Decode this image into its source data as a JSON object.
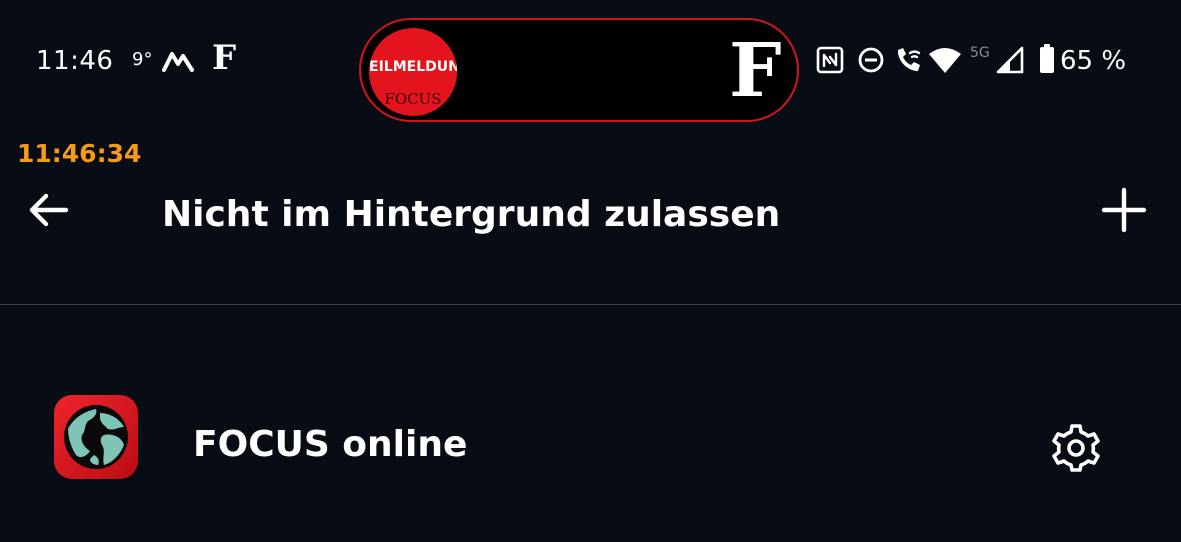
{
  "status_bar": {
    "time": "11:46",
    "temperature": "9°",
    "battery": "65 %",
    "network_label": "5G",
    "icons": [
      "mountain-app-icon",
      "focus-f-notification-icon",
      "nfc-icon",
      "do-not-disturb-icon",
      "wifi-call-icon",
      "wifi-icon",
      "cellular-signal-icon",
      "battery-icon"
    ]
  },
  "notification_pill": {
    "avatar_label": "EILMELDUNG",
    "avatar_brand": "FOCUS",
    "brand_letter": "F",
    "accent_color": "#d4141d"
  },
  "clock_overlay": {
    "time": "11:46:34",
    "color": "#f79a17"
  },
  "header": {
    "title": "Nicht im Hintergrund zulassen",
    "back_icon": "arrow-left-icon",
    "add_icon": "plus-icon"
  },
  "apps": [
    {
      "name": "FOCUS online",
      "icon": "focus-online-globe-icon",
      "settings_icon": "gear-icon"
    }
  ],
  "colors": {
    "background": "#080c14",
    "text": "#ffffff",
    "divider": "#3a3e46",
    "focus_red": "#e3141d"
  }
}
